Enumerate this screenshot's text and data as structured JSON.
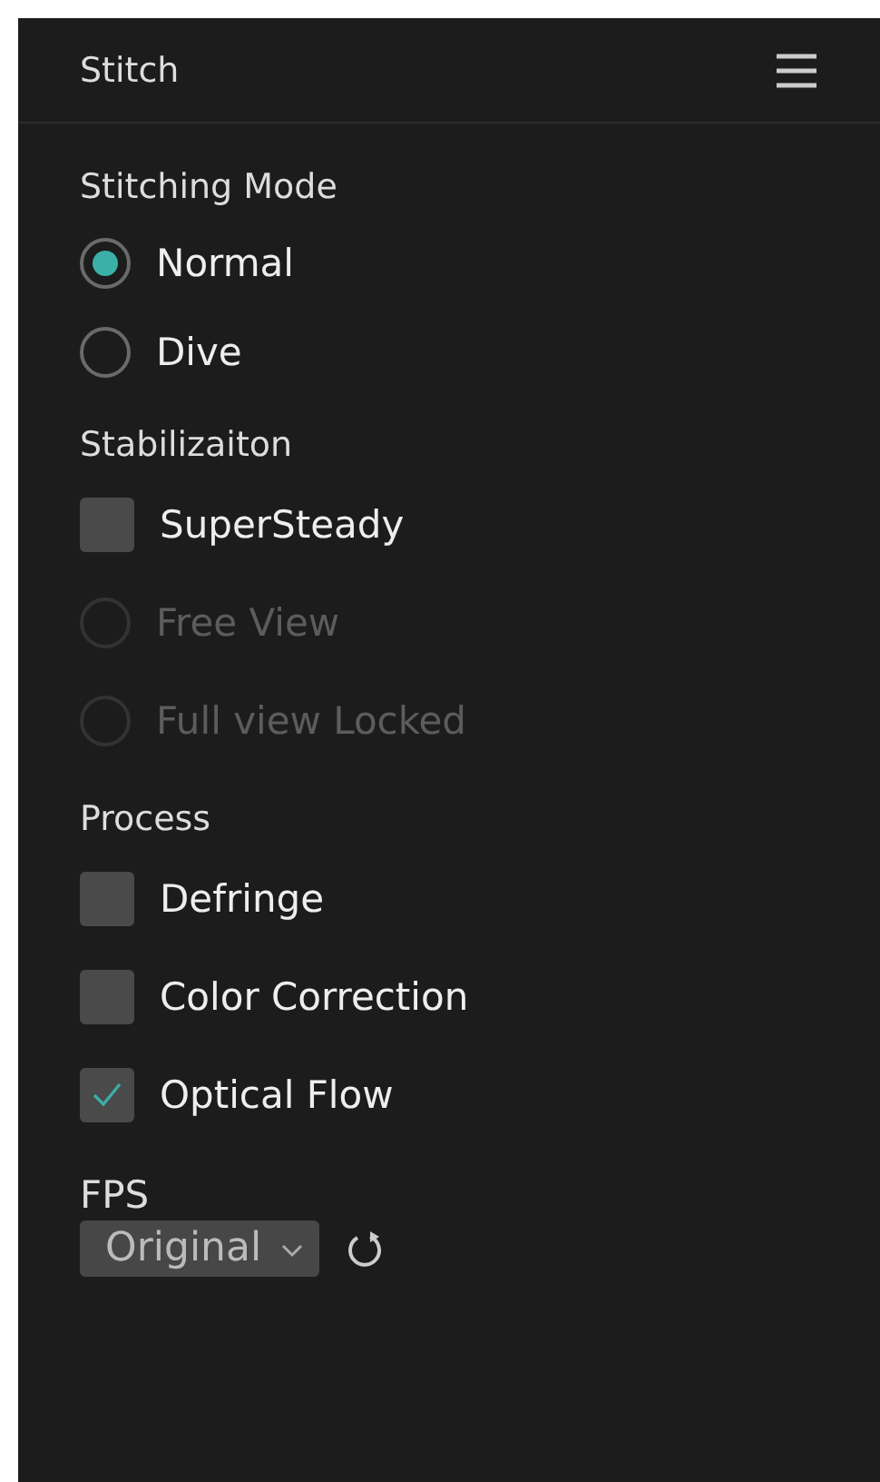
{
  "header": {
    "title": "Stitch"
  },
  "sections": [
    {
      "title": "Stitching Mode",
      "items": [
        {
          "kind": "radio",
          "label": "Normal",
          "selected": true,
          "disabled": false
        },
        {
          "kind": "radio",
          "label": "Dive",
          "selected": false,
          "disabled": false
        }
      ]
    },
    {
      "title": "Stabilizaiton",
      "items": [
        {
          "kind": "checkbox",
          "label": "SuperSteady",
          "checked": false,
          "disabled": false
        },
        {
          "kind": "radio",
          "label": "Free View",
          "selected": false,
          "disabled": true
        },
        {
          "kind": "radio",
          "label": "Full view Locked",
          "selected": false,
          "disabled": true
        }
      ]
    },
    {
      "title": "Process",
      "items": [
        {
          "kind": "checkbox",
          "label": "Defringe",
          "checked": false,
          "disabled": false
        },
        {
          "kind": "checkbox",
          "label": "Color Correction",
          "checked": false,
          "disabled": false
        },
        {
          "kind": "checkbox",
          "label": "Optical Flow",
          "checked": true,
          "disabled": false
        }
      ]
    }
  ],
  "fps": {
    "label": "FPS",
    "value": "Original"
  }
}
